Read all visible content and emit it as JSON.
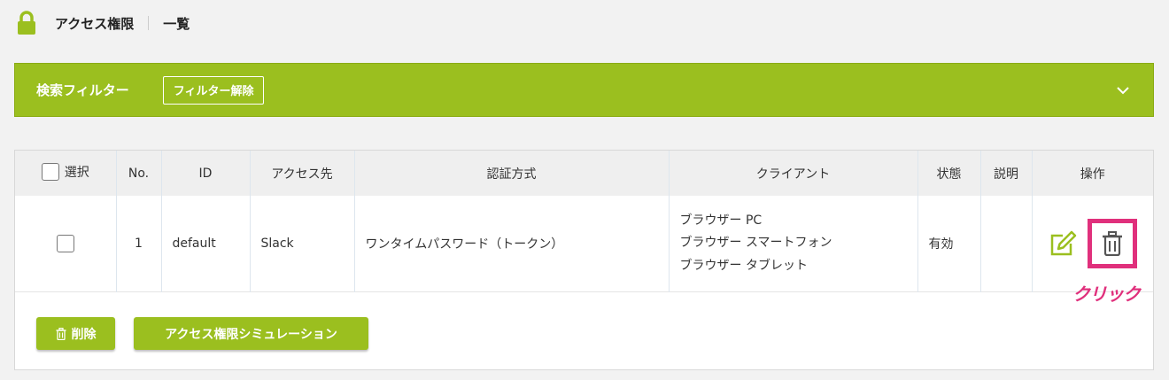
{
  "header": {
    "title": "アクセス権限",
    "subtitle": "一覧",
    "icon": "lock-icon"
  },
  "filter": {
    "title": "検索フィルター",
    "clear_label": "フィルター解除"
  },
  "table": {
    "columns": [
      "選択",
      "No.",
      "ID",
      "アクセス先",
      "認証方式",
      "クライアント",
      "状態",
      "説明",
      "操作"
    ],
    "rows": [
      {
        "no": "1",
        "id": "default",
        "access_to": "Slack",
        "auth_method": "ワンタイムパスワード（トークン）",
        "clients": [
          "ブラウザー PC",
          "ブラウザー スマートフォン",
          "ブラウザー タブレット"
        ],
        "status": "有効",
        "description": ""
      }
    ]
  },
  "buttons": {
    "delete_label": "削除",
    "simulation_label": "アクセス権限シミュレーション"
  },
  "annotation": {
    "click_label": "クリック"
  },
  "colors": {
    "accent": "#9bbf1f",
    "highlight": "#e0307c"
  }
}
